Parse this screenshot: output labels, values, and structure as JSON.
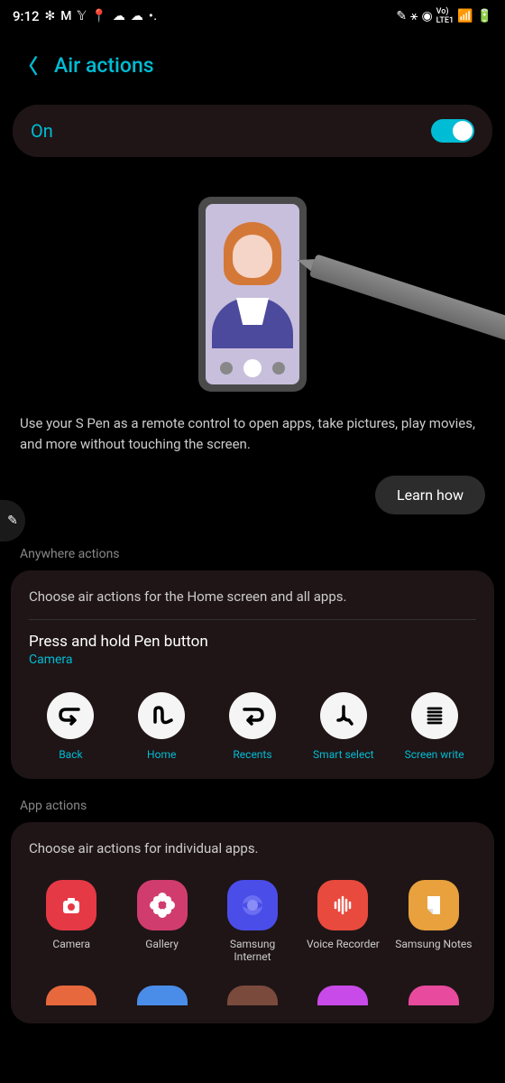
{
  "status_bar": {
    "time": "9:12",
    "lte_label": "LTE1",
    "vo_label": "Vo)"
  },
  "header": {
    "title": "Air actions"
  },
  "toggle": {
    "label": "On",
    "state": "on"
  },
  "description": "Use your S Pen as a remote control to open apps, take pictures, play movies, and more without touching the screen.",
  "learn_button": "Learn how",
  "sections": {
    "anywhere": {
      "label": "Anywhere actions",
      "description": "Choose air actions for the Home screen and all apps.",
      "pen_action": {
        "title": "Press and hold Pen button",
        "value": "Camera"
      },
      "gestures": [
        {
          "label": "Back"
        },
        {
          "label": "Home"
        },
        {
          "label": "Recents"
        },
        {
          "label": "Smart select"
        },
        {
          "label": "Screen write"
        }
      ]
    },
    "app": {
      "label": "App actions",
      "description": "Choose air actions for individual apps.",
      "apps": [
        {
          "label": "Camera",
          "color": "#e63946"
        },
        {
          "label": "Gallery",
          "color": "#d13c6e"
        },
        {
          "label": "Samsung Internet",
          "color": "#4a4de8"
        },
        {
          "label": "Voice Recorder",
          "color": "#e84a3d"
        },
        {
          "label": "Samsung Notes",
          "color": "#e8a13d"
        }
      ]
    }
  }
}
